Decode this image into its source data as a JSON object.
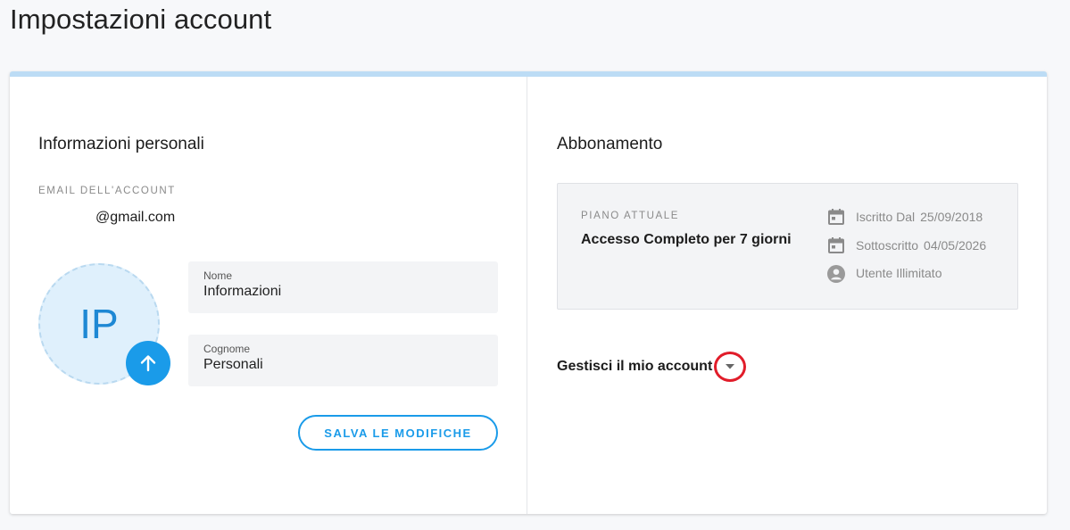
{
  "page": {
    "title": "Impostazioni account"
  },
  "personal": {
    "heading": "Informazioni personali",
    "email_caption": "EMAIL DELL'ACCOUNT",
    "email_value": "@gmail.com",
    "avatar_initials": "IP",
    "upload_icon": "arrow-up-icon",
    "first_name": {
      "label": "Nome",
      "value": "Informazioni"
    },
    "last_name": {
      "label": "Cognome",
      "value": "Personali"
    },
    "save_label": "SALVA LE MODIFICHE"
  },
  "subscription": {
    "heading": "Abbonamento",
    "plan_caption": "PIANO ATTUALE",
    "plan_name": "Accesso Completo per 7 giorni",
    "meta": [
      {
        "icon": "calendar-icon",
        "label": "Iscritto Dal",
        "value": "25/09/2018"
      },
      {
        "icon": "calendar-icon",
        "label": "Sottoscritto",
        "value": "04/05/2026"
      },
      {
        "icon": "user-icon",
        "label": "Utente Illimitato",
        "value": ""
      }
    ],
    "manage_label": "Gestisci il mio account",
    "manage_icon": "caret-down-icon"
  },
  "colors": {
    "accent": "#1a9be9",
    "card_top_border": "#bcdcf5",
    "highlight_circle": "#e11d2a"
  }
}
